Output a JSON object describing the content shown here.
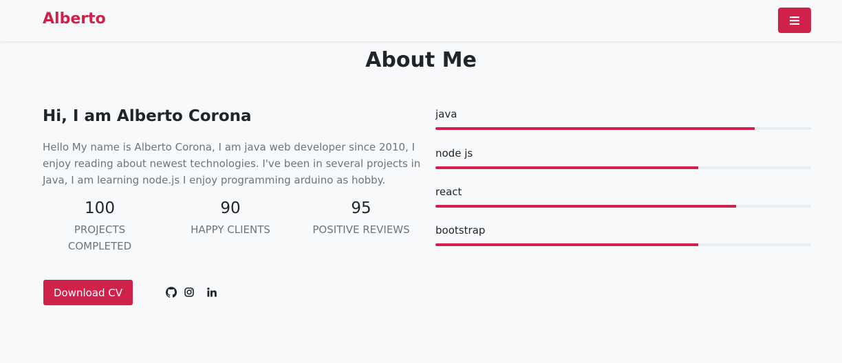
{
  "navbar": {
    "brand": "Alberto",
    "menu_icon": "hamburger-menu-icon"
  },
  "about": {
    "title": "About Me",
    "greeting": "Hi, I am Alberto Corona",
    "bio": "Hello My name is Alberto Corona, I am java web developer since 2010, I enjoy reading about newest technologies. I've been in several projects in Java, I am learning node.js I enjoy programming arduino as hobby.",
    "stats": [
      {
        "value": "100",
        "label": "PROJECTS COMPLETED"
      },
      {
        "value": "90",
        "label": "HAPPY CLIENTS"
      },
      {
        "value": "95",
        "label": "POSITIVE REVIEWS"
      }
    ],
    "download_label": "Download CV",
    "social": [
      "github-icon",
      "instagram-icon",
      "linkedin-icon"
    ]
  },
  "skills": [
    {
      "name": "java",
      "level": 0.85
    },
    {
      "name": "node js",
      "level": 0.7
    },
    {
      "name": "react",
      "level": 0.8
    },
    {
      "name": "bootstrap",
      "level": 0.7
    }
  ],
  "colors": {
    "accent": "#d0214a",
    "track": "#e9ecef",
    "muted": "#6c757d",
    "background": "#f8f9fb"
  }
}
